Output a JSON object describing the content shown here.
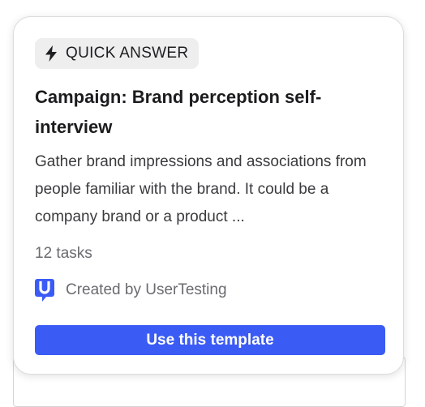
{
  "badge": {
    "icon": "lightning-bolt-icon",
    "label": "QUICK ANSWER"
  },
  "template": {
    "title": "Campaign: Brand perception self-interview",
    "description": "Gather brand impressions and associations from people familiar with the brand. It could be a company brand or a product ...",
    "task_count": "12 tasks",
    "creator_logo": "usertesting-logo-icon",
    "creator_text": "Created by UserTesting",
    "cta_label": "Use this template"
  },
  "colors": {
    "accent": "#3b5bf5",
    "badge_bg": "#eeeeef"
  }
}
